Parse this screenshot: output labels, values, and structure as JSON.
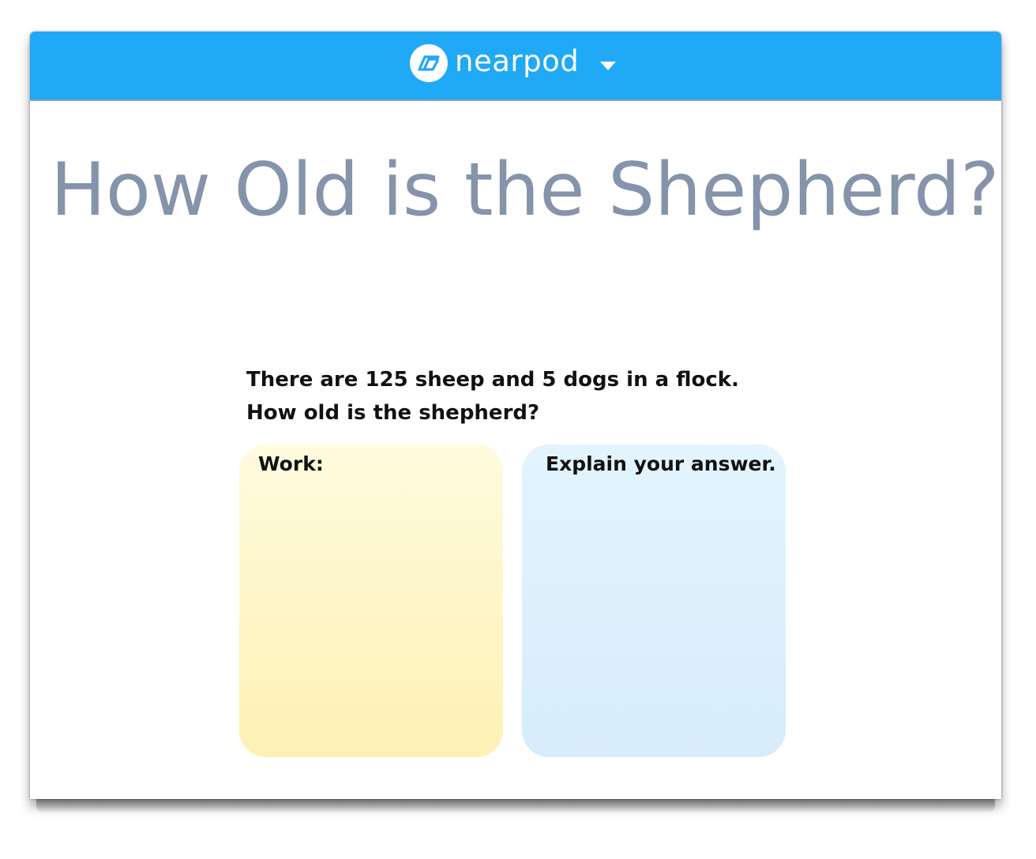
{
  "header": {
    "brand_name": "nearpod",
    "logo_icon": "nearpod-logo-icon",
    "menu_icon": "chevron-down-icon",
    "bar_color": "#1fa9f7"
  },
  "slide": {
    "title": "How Old is the Shepherd?",
    "question_line1": "There are 125 sheep and 5 dogs in a flock.",
    "question_line2": "How old is the shepherd?",
    "work_label": "Work:",
    "explain_label": "Explain your answer.",
    "title_color": "#8593ab",
    "work_color": "#fdf4c4",
    "explain_color": "#dcf0fc"
  }
}
